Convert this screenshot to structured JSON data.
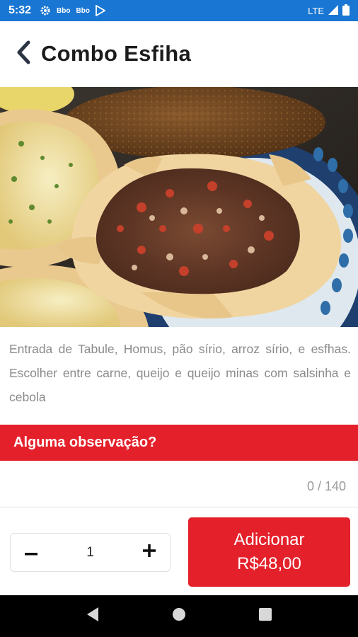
{
  "status_bar": {
    "time": "5:32",
    "network": "LTE",
    "notif_icons": [
      "gear-icon",
      "app-badge-icon",
      "app-badge-icon",
      "play-store-icon"
    ],
    "notif_labels": [
      "Bbo",
      "Bbo"
    ]
  },
  "header": {
    "title": "Combo Esfiha",
    "back_icon": "chevron-left-icon"
  },
  "product": {
    "image_alt": "esfiha-photo",
    "description": "Entrada de Tabule, Homus, pão sírio, arroz sírio, e esfhas. Escolher entre carne, queijo e queijo minas com salsinha e cebola"
  },
  "observation": {
    "label": "Alguma observação?",
    "value": "",
    "counter": "0 / 140"
  },
  "quantity": {
    "value": "1",
    "minus_icon": "minus-icon",
    "plus_icon": "plus-icon"
  },
  "add_button": {
    "label": "Adicionar",
    "price": "R$48,00"
  },
  "colors": {
    "accent": "#e4202a",
    "status_bar": "#1976d2",
    "nav_bar": "#000000"
  },
  "nav_bar": {
    "icons": [
      "back-icon",
      "home-icon",
      "recents-icon"
    ]
  }
}
